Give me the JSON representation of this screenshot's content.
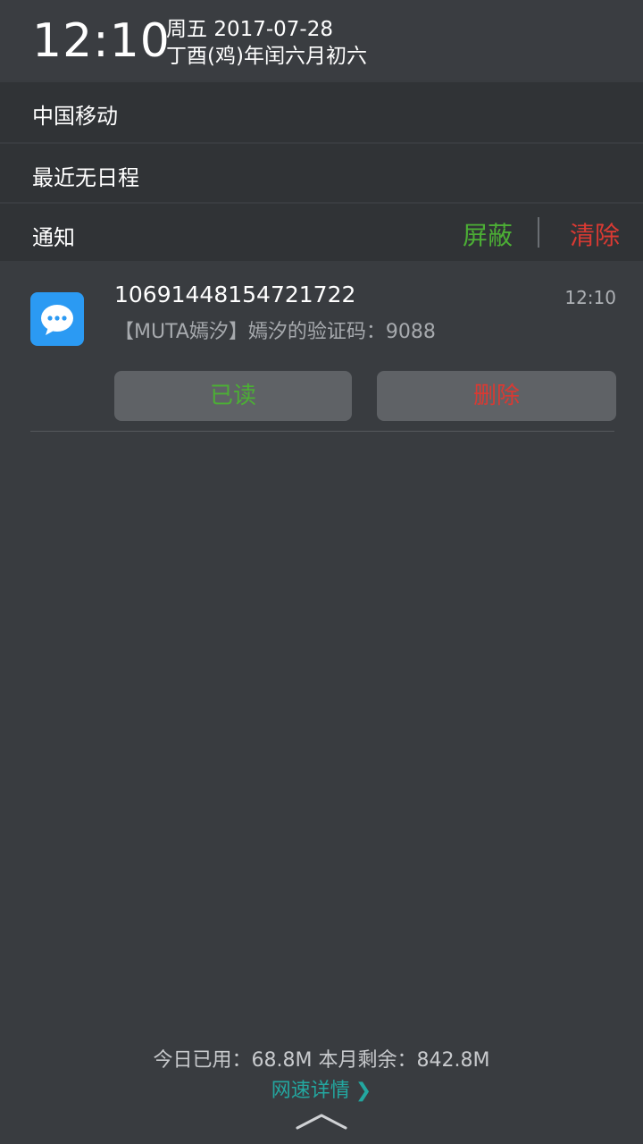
{
  "header": {
    "clock": "12:10",
    "weekday": "周五",
    "date": "2017-07-28",
    "lunar": "丁酉(鸡)年闰六月初六"
  },
  "carrier": "中国移动",
  "schedule": "最近无日程",
  "notifications_header": {
    "title": "通知",
    "block_label": "屏蔽",
    "clear_label": "清除"
  },
  "notification": {
    "app_icon": "message-bubble-icon",
    "sender": "10691448154721722",
    "time": "12:10",
    "body": "【MUTA嫣汐】嫣汐的验证码：9088",
    "mark_read_label": "已读",
    "delete_label": "删除"
  },
  "footer": {
    "data_usage": "今日已用：68.8M  本月剩余：842.8M",
    "speed_details": "网速详情",
    "speed_chevron": "❯"
  },
  "colors": {
    "accent_green": "#4caf35",
    "accent_red": "#d93a33",
    "link_teal": "#23a7a0",
    "message_blue": "#2b9af3"
  }
}
